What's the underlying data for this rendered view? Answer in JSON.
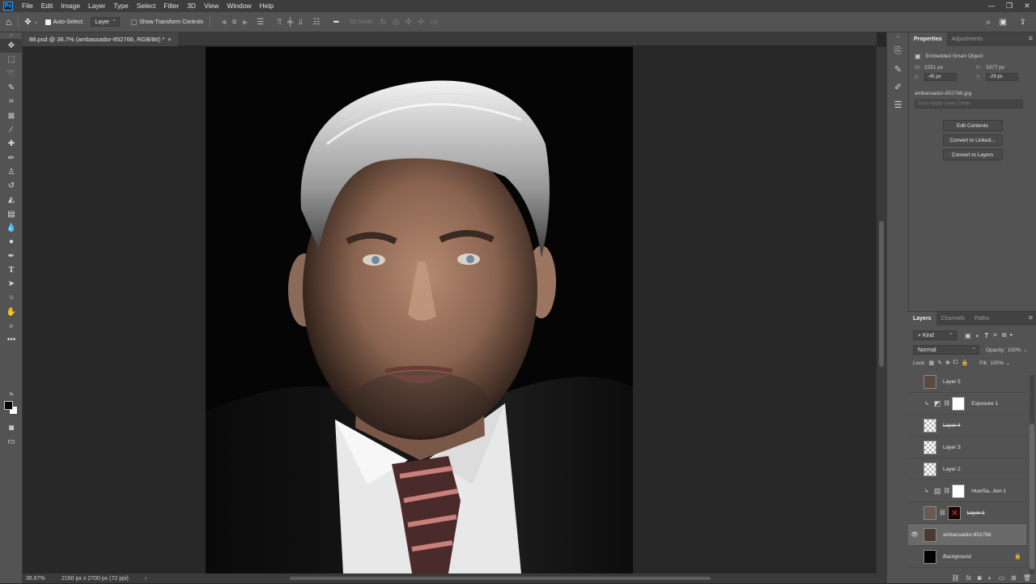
{
  "app": {
    "logo": "Ps"
  },
  "menu": [
    "File",
    "Edit",
    "Image",
    "Layer",
    "Type",
    "Select",
    "Filter",
    "3D",
    "View",
    "Window",
    "Help"
  ],
  "window_controls": [
    "—",
    "❐",
    "✕"
  ],
  "options_bar": {
    "auto_select_label": "Auto-Select:",
    "auto_select_target": "Layer",
    "show_transform_label": "Show Transform Controls",
    "mode_3d_label": "3D Mode:",
    "more_label": "•••"
  },
  "document": {
    "tab_title": "88.psd @ 36.7% (ambassador-852766, RGB/8#) *",
    "zoom": "36.67%",
    "status": "2160 px x 2700 px (72 ppi)"
  },
  "properties": {
    "tabs": [
      "Properties",
      "Adjustments"
    ],
    "object_type": "Embedded Smart Object",
    "w_label": "W:",
    "w_value": "2251 px",
    "h_label": "H:",
    "h_value": "3377 px",
    "x_label": "X:",
    "x_value": "-45 px",
    "y_label": "Y:",
    "y_value": "-29 px",
    "filename": "ambassador-852766.jpg",
    "layer_comp": "Don't Apply Layer Comp",
    "buttons": [
      "Edit Contents",
      "Convert to Linked...",
      "Convert to Layers"
    ]
  },
  "layers": {
    "tabs": [
      "Layers",
      "Channels",
      "Paths"
    ],
    "filter_kind": "Kind",
    "blend_mode": "Normal",
    "opacity_label": "Opacity:",
    "opacity_value": "100%",
    "lock_label": "Lock:",
    "fill_label": "Fill:",
    "fill_value": "100%",
    "items": [
      {
        "name": "Layer 5",
        "visible": false
      },
      {
        "name": "Exposure 1",
        "visible": false
      },
      {
        "name": "Layer 4",
        "visible": false
      },
      {
        "name": "Layer 3",
        "visible": false
      },
      {
        "name": "Layer 2",
        "visible": false
      },
      {
        "name": "Hue/Sa...tion 1",
        "visible": false
      },
      {
        "name": "Layer 1",
        "visible": false
      },
      {
        "name": "ambassador-852766",
        "visible": true
      },
      {
        "name": "Background",
        "visible": false
      }
    ]
  },
  "colors": {
    "accent": "#31a8ff",
    "panel": "#535353",
    "dark": "#282828"
  }
}
